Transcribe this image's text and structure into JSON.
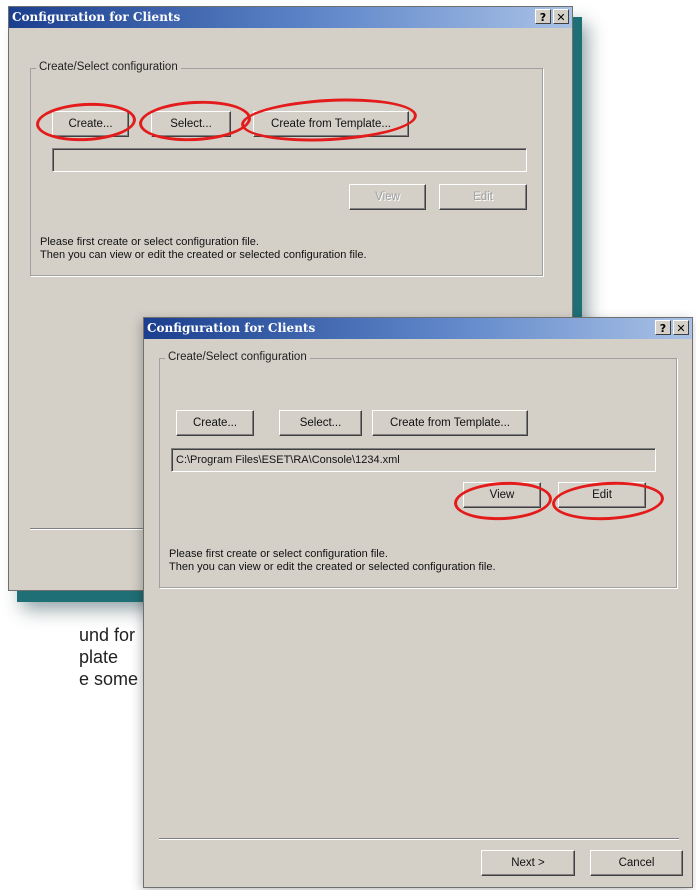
{
  "dialog_back": {
    "title": "Configuration for Clients",
    "help_btn": "?",
    "close_btn": "✕",
    "group_label": "Create/Select configuration",
    "create_btn": "Create...",
    "select_btn": "Select...",
    "template_btn": "Create from Template...",
    "path_value": "",
    "view_btn": "View",
    "edit_btn": "Edit",
    "info_line1": "Please first create or select configuration file.",
    "info_line2": "Then you can view or edit the created or selected configuration file."
  },
  "dialog_front": {
    "title": "Configuration for Clients",
    "help_btn": "?",
    "close_btn": "✕",
    "group_label": "Create/Select configuration",
    "create_btn": "Create...",
    "select_btn": "Select...",
    "template_btn": "Create from Template...",
    "path_value": "C:\\Program Files\\ESET\\RA\\Console\\1234.xml",
    "view_btn": "View",
    "edit_btn": "Edit",
    "info_line1": "Please first create or select configuration file.",
    "info_line2": "Then you can view or edit the created or selected configuration file.",
    "next_btn": "Next >",
    "cancel_btn": "Cancel"
  },
  "caption": {
    "line1": "und for",
    "line2": "plate",
    "line3": "e some"
  },
  "colors": {
    "highlight": "#e41b1b",
    "shadow_teal": "#1f6f77",
    "titlebar_start": "#1b3f8e"
  }
}
